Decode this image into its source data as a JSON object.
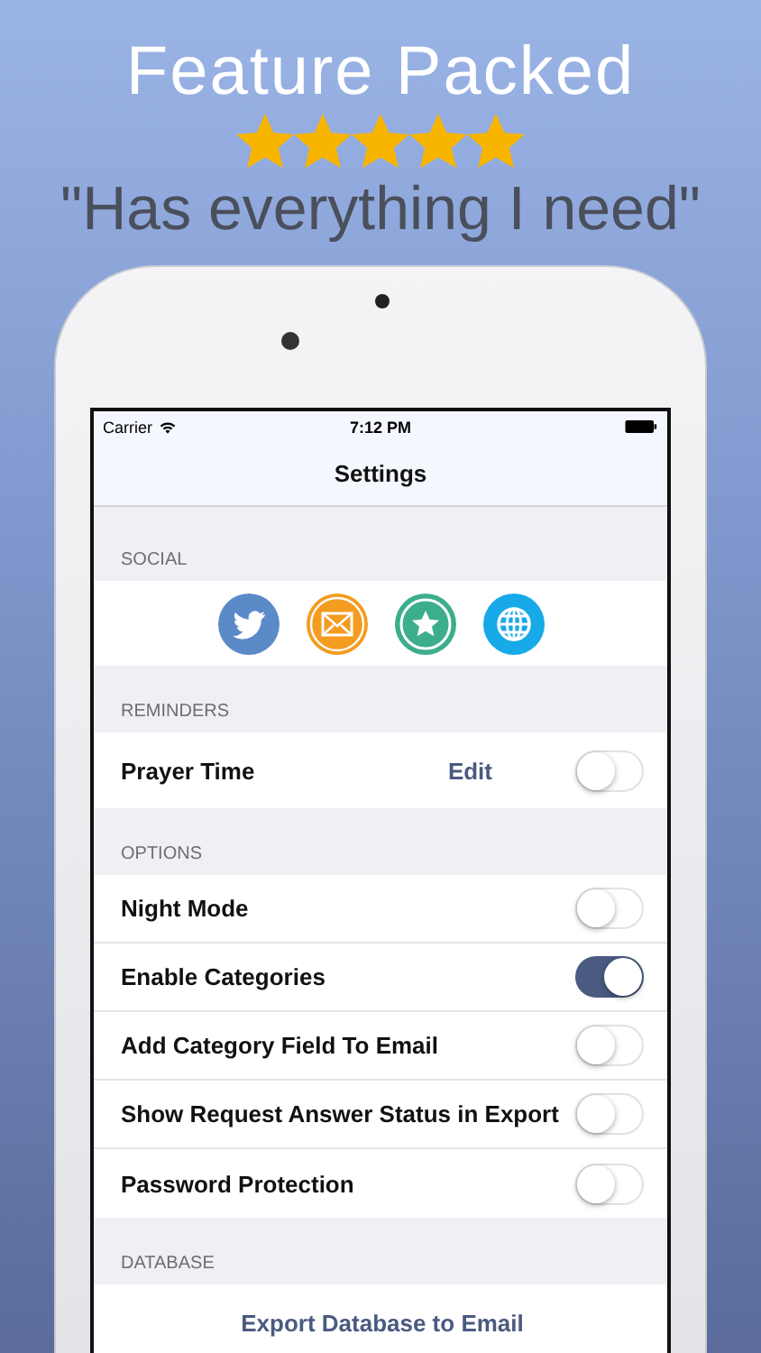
{
  "headline": "Feature Packed",
  "stars": 5,
  "tagline": "\"Has everything I need\"",
  "status_bar": {
    "carrier": "Carrier",
    "time": "7:12 PM"
  },
  "nav_title": "Settings",
  "sections": [
    {
      "header": "SOCIAL",
      "items": [
        {
          "kind": "icons"
        }
      ]
    },
    {
      "header": "REMINDERS",
      "items": [
        {
          "kind": "toggle",
          "label": "Prayer Time",
          "action": "Edit",
          "on": false
        }
      ]
    },
    {
      "header": "OPTIONS",
      "items": [
        {
          "kind": "toggle",
          "label": "Night Mode",
          "on": false
        },
        {
          "kind": "toggle",
          "label": "Enable Categories",
          "on": true
        },
        {
          "kind": "toggle",
          "label": "Add Category Field To Email",
          "on": false
        },
        {
          "kind": "toggle",
          "label": "Show Request Answer Status in Export",
          "on": false
        },
        {
          "kind": "toggle",
          "label": "Password Protection",
          "on": false
        }
      ]
    },
    {
      "header": "DATABASE",
      "items": [
        {
          "kind": "button",
          "label": "Export Database to Email"
        }
      ]
    }
  ]
}
